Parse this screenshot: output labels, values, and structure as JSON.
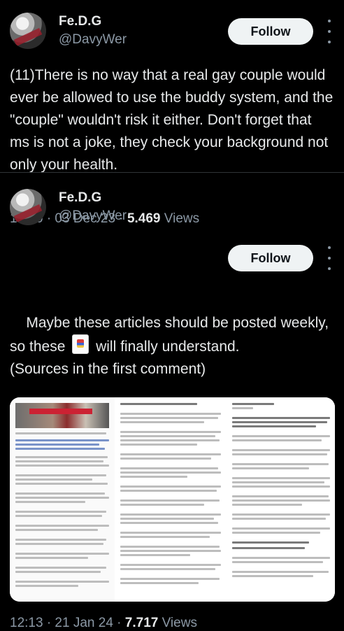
{
  "tweets": [
    {
      "display_name": "Fe.D.G",
      "handle": "@DavyWer",
      "follow_label": "Follow",
      "text": "(11)There is no way that a real gay couple would ever be allowed to use the buddy system, and the \"couple\" wouldn't risk it either. Don't forget that ms is not a joke, they check your background not only your health.",
      "time": "10:10 · 03 Dec 23 · ",
      "views_count": "5.469",
      "views_label": " Views"
    },
    {
      "display_name": "Fe.D.G",
      "handle": "@DavyWer",
      "follow_label": "Follow",
      "text_part1": "Maybe these articles should be posted weekly, so these ",
      "emoji_name": "joker-card",
      "text_part2": " will finally understand.",
      "text_part3": "(Sources in the first comment)",
      "time": "12:13 · 21 Jan 24 · ",
      "views_count": "7.717",
      "views_label": " Views"
    }
  ],
  "icons": {
    "more": "more-vertical-icon"
  },
  "colors": {
    "background": "#000000",
    "text": "#e7e9ea",
    "secondary": "#8b98a5",
    "follow_bg": "#eff3f4",
    "divider": "#2f3336"
  }
}
